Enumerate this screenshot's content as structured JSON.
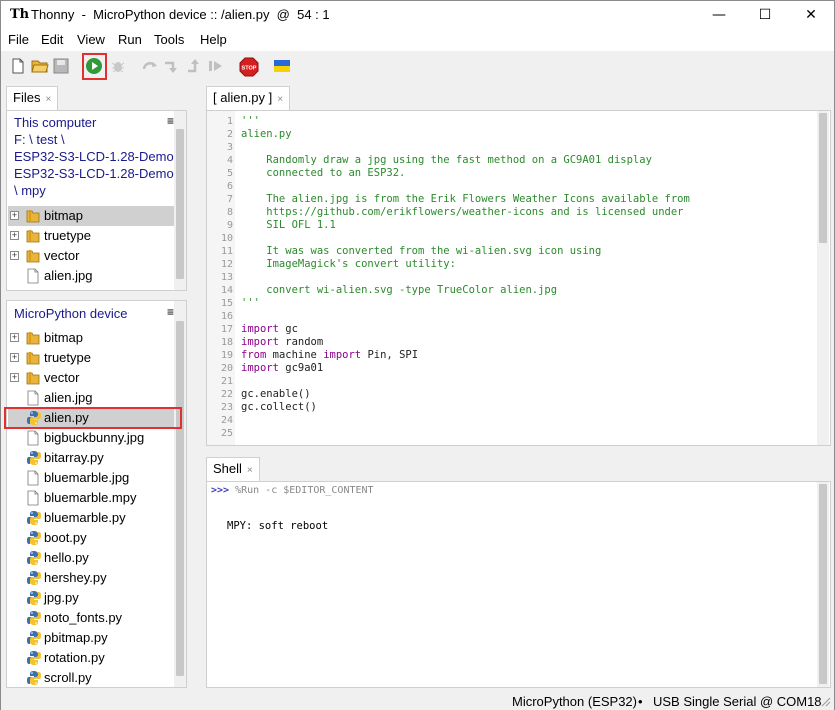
{
  "window": {
    "title": "Thonny  -  MicroPython device :: /alien.py  @  54 : 1",
    "logo": "Th",
    "minimize_glyph": "—",
    "maximize_glyph": "☐",
    "close_glyph": "✕"
  },
  "menu": [
    "File",
    "Edit",
    "View",
    "Run",
    "Tools",
    "Help"
  ],
  "toolbar": {
    "icons": [
      "new-file-icon",
      "open-file-icon",
      "save-icon",
      "run-icon",
      "debug-icon",
      "step-over-icon",
      "step-into-icon",
      "step-out-icon",
      "resume-icon",
      "stop-icon",
      "ukraine-flag-icon"
    ],
    "stop_label": "STOP"
  },
  "files_tab": {
    "label": "Files",
    "close": "×"
  },
  "this_computer": {
    "title": "This computer",
    "path_lines": [
      "F: \\ test \\",
      "ESP32-S3-LCD-1.28-Demo \\",
      " ESP32-S3-LCD-1.28-Demo",
      "\\ mpy"
    ],
    "menu_glyph": "≡",
    "items": [
      {
        "name": "bitmap",
        "type": "folder",
        "selected": true
      },
      {
        "name": "truetype",
        "type": "folder"
      },
      {
        "name": "vector",
        "type": "folder"
      },
      {
        "name": "alien.jpg",
        "type": "file"
      }
    ]
  },
  "device": {
    "title": "MicroPython device",
    "menu_glyph": "≡",
    "items": [
      {
        "name": "bitmap",
        "type": "folder"
      },
      {
        "name": "truetype",
        "type": "folder"
      },
      {
        "name": "vector",
        "type": "folder"
      },
      {
        "name": "alien.jpg",
        "type": "file"
      },
      {
        "name": "alien.py",
        "type": "python",
        "selected": true
      },
      {
        "name": "bigbuckbunny.jpg",
        "type": "file"
      },
      {
        "name": "bitarray.py",
        "type": "python"
      },
      {
        "name": "bluemarble.jpg",
        "type": "file"
      },
      {
        "name": "bluemarble.mpy",
        "type": "file"
      },
      {
        "name": "bluemarble.py",
        "type": "python"
      },
      {
        "name": "boot.py",
        "type": "python"
      },
      {
        "name": "hello.py",
        "type": "python"
      },
      {
        "name": "hershey.py",
        "type": "python"
      },
      {
        "name": "jpg.py",
        "type": "python"
      },
      {
        "name": "noto_fonts.py",
        "type": "python"
      },
      {
        "name": "pbitmap.py",
        "type": "python"
      },
      {
        "name": "rotation.py",
        "type": "python"
      },
      {
        "name": "scroll.py",
        "type": "python"
      }
    ]
  },
  "editor_tab": {
    "label": "[ alien.py ]",
    "close": "×"
  },
  "code_lines": [
    {
      "n": "1",
      "parts": [
        [
          "s",
          "'''"
        ]
      ]
    },
    {
      "n": "2",
      "parts": [
        [
          "s",
          "alien.py"
        ]
      ]
    },
    {
      "n": "3",
      "parts": []
    },
    {
      "n": "4",
      "parts": [
        [
          "s",
          "    Randomly draw a jpg using the fast method on a GC9A01 display"
        ]
      ]
    },
    {
      "n": "5",
      "parts": [
        [
          "s",
          "    connected to an ESP32."
        ]
      ]
    },
    {
      "n": "6",
      "parts": []
    },
    {
      "n": "7",
      "parts": [
        [
          "s",
          "    The alien.jpg is from the Erik Flowers Weather Icons available from"
        ]
      ]
    },
    {
      "n": "8",
      "parts": [
        [
          "s",
          "    https://github.com/erikflowers/weather-icons and is licensed under"
        ]
      ]
    },
    {
      "n": "9",
      "parts": [
        [
          "s",
          "    SIL OFL 1.1"
        ]
      ]
    },
    {
      "n": "10",
      "parts": []
    },
    {
      "n": "11",
      "parts": [
        [
          "s",
          "    It was was converted from the wi-alien.svg icon using"
        ]
      ]
    },
    {
      "n": "12",
      "parts": [
        [
          "s",
          "    ImageMagick's convert utility:"
        ]
      ]
    },
    {
      "n": "13",
      "parts": []
    },
    {
      "n": "14",
      "parts": [
        [
          "s",
          "    convert wi-alien.svg -type TrueColor alien.jpg"
        ]
      ]
    },
    {
      "n": "15",
      "parts": [
        [
          "s",
          "'''"
        ]
      ]
    },
    {
      "n": "16",
      "parts": []
    },
    {
      "n": "17",
      "parts": [
        [
          "k",
          "import"
        ],
        [
          "p",
          " gc"
        ]
      ]
    },
    {
      "n": "18",
      "parts": [
        [
          "k",
          "import"
        ],
        [
          "p",
          " random"
        ]
      ]
    },
    {
      "n": "19",
      "parts": [
        [
          "k",
          "from"
        ],
        [
          "p",
          " machine "
        ],
        [
          "k",
          "import"
        ],
        [
          "p",
          " Pin, SPI"
        ]
      ]
    },
    {
      "n": "20",
      "parts": [
        [
          "k",
          "import"
        ],
        [
          "p",
          " gc9a01"
        ]
      ]
    },
    {
      "n": "21",
      "parts": []
    },
    {
      "n": "22",
      "parts": [
        [
          "p",
          "gc.enable()"
        ]
      ]
    },
    {
      "n": "23",
      "parts": [
        [
          "p",
          "gc.collect()"
        ]
      ]
    },
    {
      "n": "24",
      "parts": []
    },
    {
      "n": "25",
      "parts": []
    }
  ],
  "shell_tab": {
    "label": "Shell",
    "close": "×"
  },
  "shell": {
    "prompt": ">>>",
    "command": " %Run -c $EDITOR_CONTENT",
    "output": "MPY: soft reboot"
  },
  "status": {
    "interpreter": "MicroPython (ESP32)",
    "separator": "•",
    "port": "USB Single Serial @ COM18"
  },
  "colors": {
    "string": "#2c8a2c",
    "keyword": "#8b008b",
    "link": "#1a1a8c",
    "highlight": "#e03030",
    "folder": "#e8b43c",
    "python_blue": "#3a6fb0",
    "python_yellow": "#f2c230"
  }
}
